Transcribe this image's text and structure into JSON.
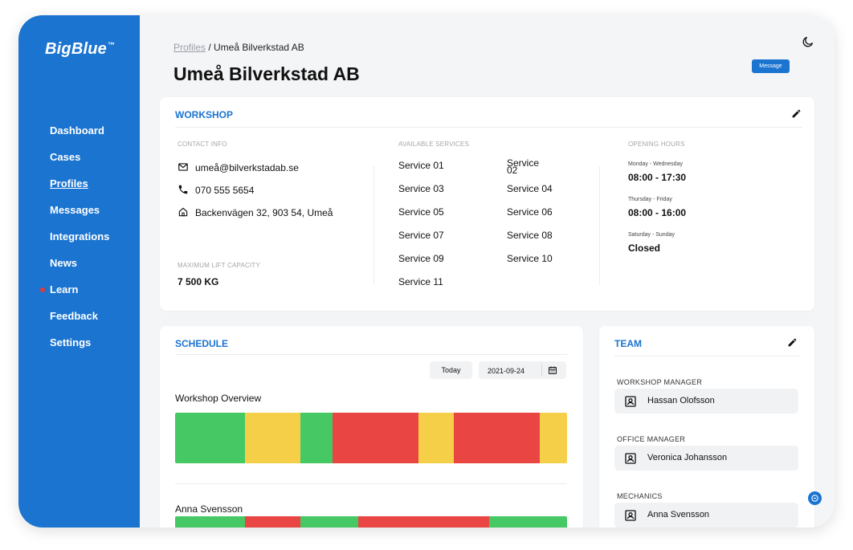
{
  "sidebar": {
    "logo": "BigBlue",
    "logo_tm": "™",
    "items": [
      {
        "label": "Dashboard"
      },
      {
        "label": "Cases"
      },
      {
        "label": "Profiles"
      },
      {
        "label": "Messages"
      },
      {
        "label": "Integrations"
      },
      {
        "label": "News"
      },
      {
        "label": "Learn"
      },
      {
        "label": "Feedback"
      },
      {
        "label": "Settings"
      }
    ],
    "active_item": "Profiles",
    "notification_item": "Learn"
  },
  "header": {
    "breadcrumb_link": "Profiles",
    "breadcrumb_current": " / Umeå Bilverkstad AB",
    "title": "Umeå Bilverkstad AB",
    "message_button": "Message"
  },
  "workshop": {
    "title": "WORKSHOP",
    "contact_label": "CONTACT INFO",
    "email": "umeå@bilverkstadab.se",
    "phone": "070 555 5654",
    "address": "Backenvägen 32, 903 54, Umeå",
    "lift_label": "MAXIMUM LIFT CAPACITY",
    "lift_value": "7 500 KG",
    "services_label": "AVAILABLE SERVICES",
    "services": [
      "Service 01",
      "Service 02",
      "Service 03",
      "Service 04",
      "Service 05",
      "Service 06",
      "Service 07",
      "Service 08",
      "Service 09",
      "Service 10",
      "Service 11"
    ],
    "hours_label": "OPENING HOURS",
    "hours": [
      {
        "days": "Monday - Wednesday",
        "time": "08:00 - 17:30"
      },
      {
        "days": "Thursday - Friday",
        "time": "08:00 - 16:00"
      },
      {
        "days": "Saturday - Sunday",
        "time": "Closed"
      }
    ]
  },
  "schedule": {
    "title": "SCHEDULE",
    "today_button": "Today",
    "date": "2021-09-24",
    "rows": [
      {
        "name": "Workshop Overview",
        "segments": [
          {
            "status": "green",
            "fraction": 0.179
          },
          {
            "status": "yellow",
            "fraction": 0.141
          },
          {
            "status": "green",
            "fraction": 0.082
          },
          {
            "status": "red",
            "fraction": 0.218
          },
          {
            "status": "yellow",
            "fraction": 0.092
          },
          {
            "status": "red",
            "fraction": 0.218
          },
          {
            "status": "yellow",
            "fraction": 0.07
          }
        ]
      },
      {
        "name": "Anna Svensson",
        "segments": [
          {
            "status": "green",
            "fraction": 0.179
          },
          {
            "status": "red",
            "fraction": 0.141
          },
          {
            "status": "green",
            "fraction": 0.148
          },
          {
            "status": "red",
            "fraction": 0.334
          },
          {
            "status": "green",
            "fraction": 0.198
          }
        ]
      }
    ]
  },
  "team": {
    "title": "TEAM",
    "groups": [
      {
        "label": "WORKSHOP MANAGER",
        "member": "Hassan Olofsson"
      },
      {
        "label": "OFFICE MANAGER",
        "member": "Veronica Johansson"
      },
      {
        "label": "MECHANICS",
        "member": "Anna Svensson"
      }
    ]
  },
  "colors": {
    "brand": "#1b74d0",
    "green": "#46c965",
    "yellow": "#f6cf49",
    "red": "#e84543"
  }
}
